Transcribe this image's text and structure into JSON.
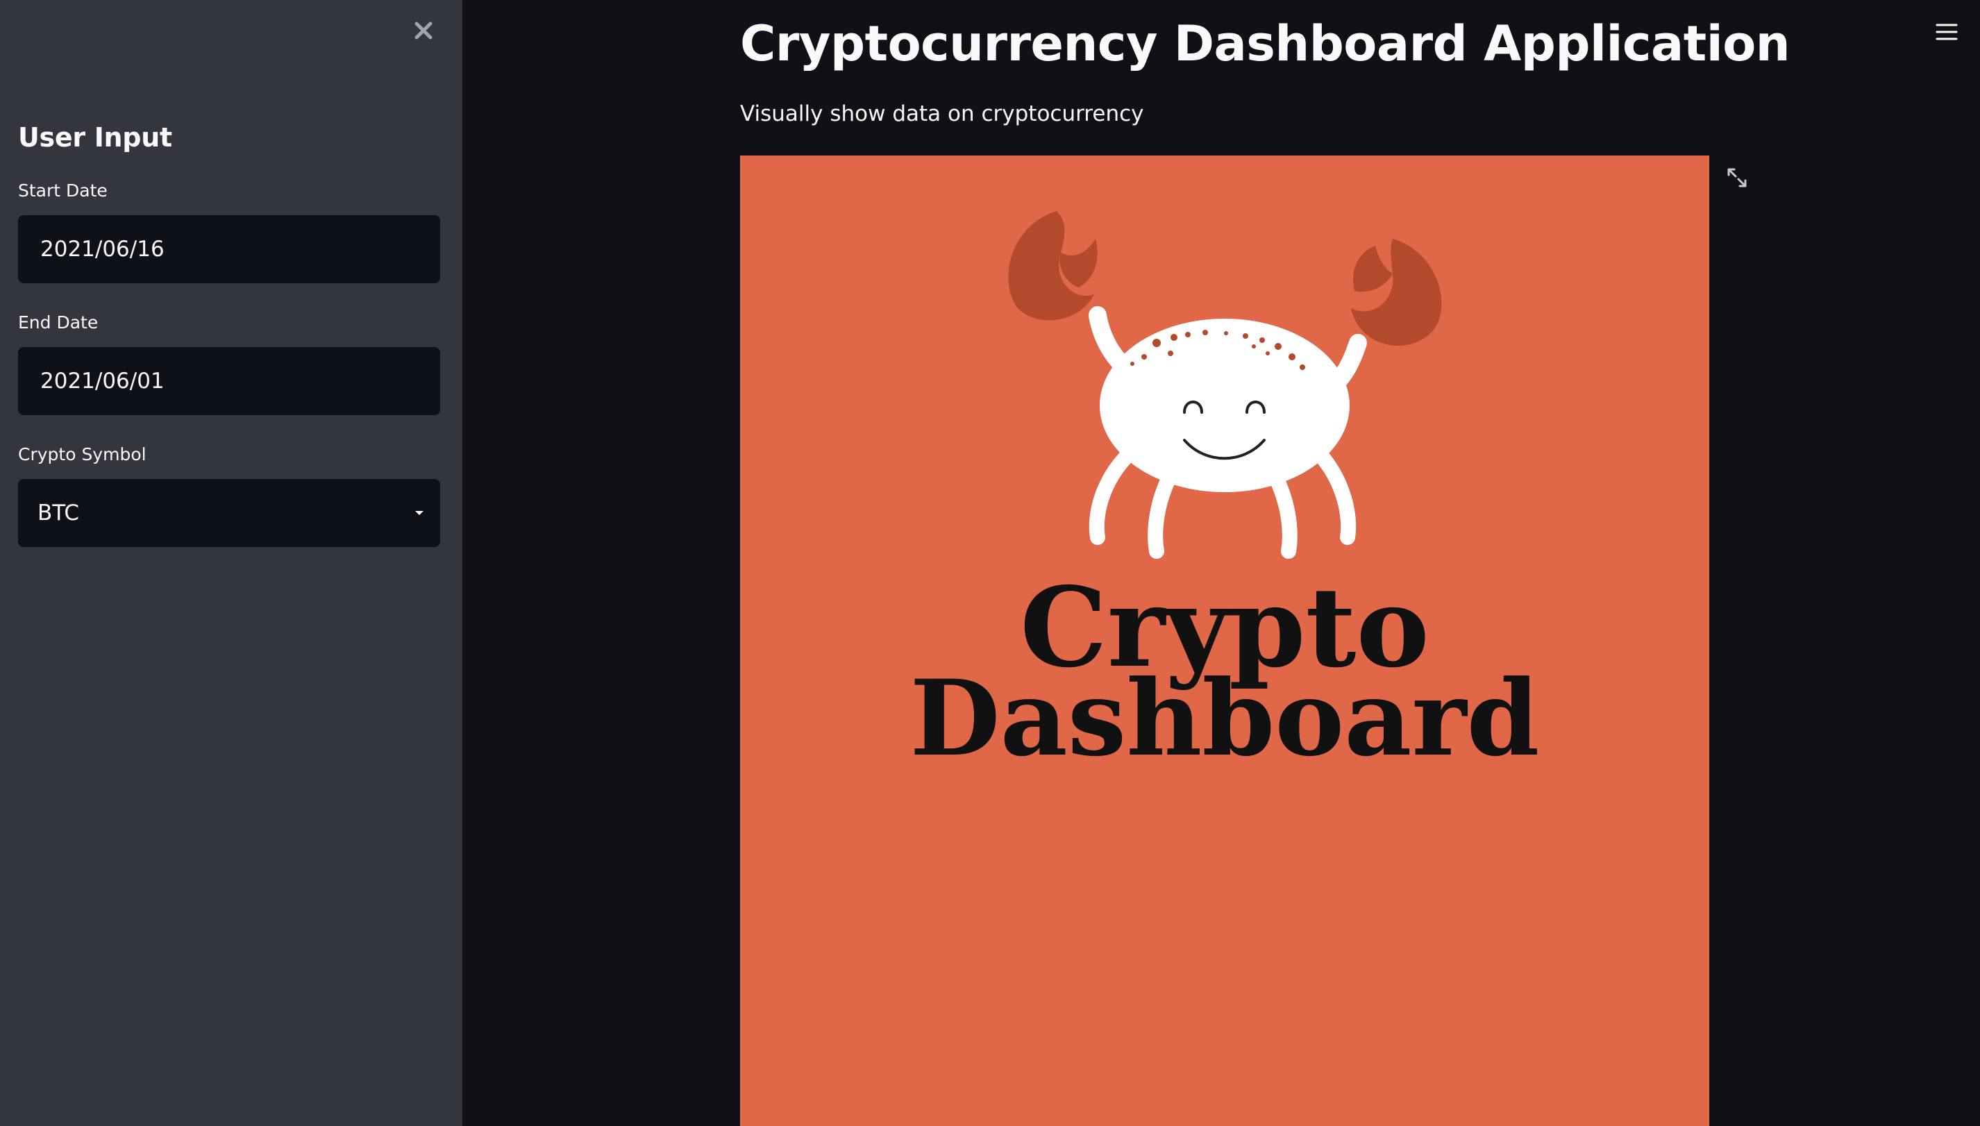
{
  "sidebar": {
    "title": "User Input",
    "start_date": {
      "label": "Start Date",
      "value": "2021/06/16"
    },
    "end_date": {
      "label": "End Date",
      "value": "2021/06/01"
    },
    "crypto_symbol": {
      "label": "Crypto Symbol",
      "value": "BTC"
    },
    "close_icon": "close-icon"
  },
  "main": {
    "title": "Cryptocurrency Dashboard Application",
    "subtitle": "Visually show data on cryptocurrency",
    "image": {
      "text_line1": "Crypto",
      "text_line2": "Dashboard",
      "background": "#e06747"
    },
    "fullscreen_icon": "expand-icon",
    "menu_icon": "hamburger-menu-icon"
  },
  "colors": {
    "sidebar_bg": "#33353f",
    "main_bg": "#0f1116",
    "input_bg": "#0e1117",
    "text": "#fafafa",
    "claw": "#b44a2c"
  }
}
